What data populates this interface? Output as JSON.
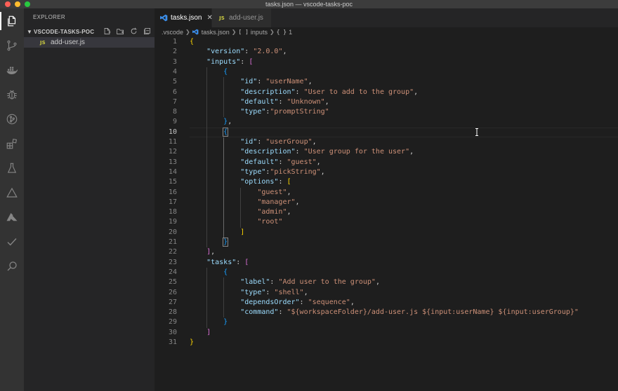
{
  "window": {
    "title": "tasks.json — vscode-tasks-poc"
  },
  "activity_bar": {
    "icons": [
      "explorer-icon",
      "source-control-icon",
      "docker-icon",
      "debug-icon",
      "git-graph-icon",
      "extensions-icon",
      "testing-icon",
      "deployment-icon",
      "azure-icon",
      "check-icon",
      "search-icon"
    ]
  },
  "sidebar": {
    "title": "EXPLORER",
    "folder": "VSCODE-TASKS-POC",
    "files": [
      {
        "badge": "JS",
        "name": "add-user.js"
      }
    ]
  },
  "tabs": [
    {
      "label": "tasks.json",
      "active": true
    },
    {
      "label": "add-user.js",
      "active": false,
      "badge": "JS"
    }
  ],
  "breadcrumb": {
    "folder": ".vscode",
    "file": "tasks.json",
    "symbol1_icon": "[ ]",
    "symbol1": "inputs",
    "symbol2_icon": "{ }",
    "symbol2": "1"
  },
  "editor": {
    "cursor_line": 10,
    "line_numbers": [
      "1",
      "2",
      "3",
      "4",
      "5",
      "6",
      "7",
      "8",
      "9",
      "10",
      "11",
      "12",
      "13",
      "14",
      "15",
      "16",
      "17",
      "18",
      "19",
      "20",
      "21",
      "22",
      "23",
      "24",
      "25",
      "26",
      "27",
      "28",
      "29",
      "30",
      "31"
    ],
    "lines": [
      [
        [
          "b1",
          "{"
        ]
      ],
      [
        [
          "p",
          "    "
        ],
        [
          "k",
          "\"version\""
        ],
        [
          "p",
          ": "
        ],
        [
          "s",
          "\"2.0.0\""
        ],
        [
          "p",
          ","
        ]
      ],
      [
        [
          "p",
          "    "
        ],
        [
          "k",
          "\"inputs\""
        ],
        [
          "p",
          ": "
        ],
        [
          "b2",
          "["
        ]
      ],
      [
        [
          "p",
          "        "
        ],
        [
          "b3",
          "{"
        ]
      ],
      [
        [
          "p",
          "            "
        ],
        [
          "k",
          "\"id\""
        ],
        [
          "p",
          ": "
        ],
        [
          "s",
          "\"userName\""
        ],
        [
          "p",
          ","
        ]
      ],
      [
        [
          "p",
          "            "
        ],
        [
          "k",
          "\"description\""
        ],
        [
          "p",
          ": "
        ],
        [
          "s",
          "\"User to add to the group\""
        ],
        [
          "p",
          ","
        ]
      ],
      [
        [
          "p",
          "            "
        ],
        [
          "k",
          "\"default\""
        ],
        [
          "p",
          ": "
        ],
        [
          "s",
          "\"Unknown\""
        ],
        [
          "p",
          ","
        ]
      ],
      [
        [
          "p",
          "            "
        ],
        [
          "k",
          "\"type\""
        ],
        [
          "p",
          ":"
        ],
        [
          "s",
          "\"promptString\""
        ]
      ],
      [
        [
          "p",
          "        "
        ],
        [
          "b3",
          "}"
        ],
        [
          "p",
          ","
        ]
      ],
      [
        [
          "p",
          "        "
        ],
        [
          "b3 matchbox",
          "{"
        ]
      ],
      [
        [
          "p",
          "            "
        ],
        [
          "k",
          "\"id\""
        ],
        [
          "p",
          ": "
        ],
        [
          "s",
          "\"userGroup\""
        ],
        [
          "p",
          ","
        ]
      ],
      [
        [
          "p",
          "            "
        ],
        [
          "k",
          "\"description\""
        ],
        [
          "p",
          ": "
        ],
        [
          "s",
          "\"User group for the user\""
        ],
        [
          "p",
          ","
        ]
      ],
      [
        [
          "p",
          "            "
        ],
        [
          "k",
          "\"default\""
        ],
        [
          "p",
          ": "
        ],
        [
          "s",
          "\"guest\""
        ],
        [
          "p",
          ","
        ]
      ],
      [
        [
          "p",
          "            "
        ],
        [
          "k",
          "\"type\""
        ],
        [
          "p",
          ":"
        ],
        [
          "s",
          "\"pickString\""
        ],
        [
          "p",
          ","
        ]
      ],
      [
        [
          "p",
          "            "
        ],
        [
          "k",
          "\"options\""
        ],
        [
          "p",
          ": "
        ],
        [
          "b1",
          "["
        ]
      ],
      [
        [
          "p",
          "                "
        ],
        [
          "s",
          "\"guest\""
        ],
        [
          "p",
          ","
        ]
      ],
      [
        [
          "p",
          "                "
        ],
        [
          "s",
          "\"manager\""
        ],
        [
          "p",
          ","
        ]
      ],
      [
        [
          "p",
          "                "
        ],
        [
          "s",
          "\"admin\""
        ],
        [
          "p",
          ","
        ]
      ],
      [
        [
          "p",
          "                "
        ],
        [
          "s",
          "\"root\""
        ]
      ],
      [
        [
          "p",
          "            "
        ],
        [
          "b1",
          "]"
        ]
      ],
      [
        [
          "p",
          "        "
        ],
        [
          "b3 matchbox",
          "}"
        ]
      ],
      [
        [
          "p",
          "    "
        ],
        [
          "b2",
          "]"
        ],
        [
          "p",
          ","
        ]
      ],
      [
        [
          "p",
          "    "
        ],
        [
          "k",
          "\"tasks\""
        ],
        [
          "p",
          ": "
        ],
        [
          "b2",
          "["
        ]
      ],
      [
        [
          "p",
          "        "
        ],
        [
          "b3",
          "{"
        ]
      ],
      [
        [
          "p",
          "            "
        ],
        [
          "k",
          "\"label\""
        ],
        [
          "p",
          ": "
        ],
        [
          "s",
          "\"Add user to the group\""
        ],
        [
          "p",
          ","
        ]
      ],
      [
        [
          "p",
          "            "
        ],
        [
          "k",
          "\"type\""
        ],
        [
          "p",
          ": "
        ],
        [
          "s",
          "\"shell\""
        ],
        [
          "p",
          ","
        ]
      ],
      [
        [
          "p",
          "            "
        ],
        [
          "k",
          "\"dependsOrder\""
        ],
        [
          "p",
          ": "
        ],
        [
          "s",
          "\"sequence\""
        ],
        [
          "p",
          ","
        ]
      ],
      [
        [
          "p",
          "            "
        ],
        [
          "k",
          "\"command\""
        ],
        [
          "p",
          ": "
        ],
        [
          "s",
          "\"${workspaceFolder}/add-user.js ${input:userName} ${input:userGroup}\""
        ]
      ],
      [
        [
          "p",
          "        "
        ],
        [
          "b3",
          "}"
        ]
      ],
      [
        [
          "p",
          "    "
        ],
        [
          "b2",
          "]"
        ]
      ],
      [
        [
          "b1",
          "}"
        ]
      ]
    ]
  },
  "colors": {
    "key": "#9cdcfe",
    "string": "#ce9178",
    "bracket_gold": "#ffd700",
    "bracket_purple": "#da70d6",
    "bracket_blue": "#179fff",
    "js_badge": "#cbcb41",
    "vscode_blue": "#3b8eea"
  }
}
